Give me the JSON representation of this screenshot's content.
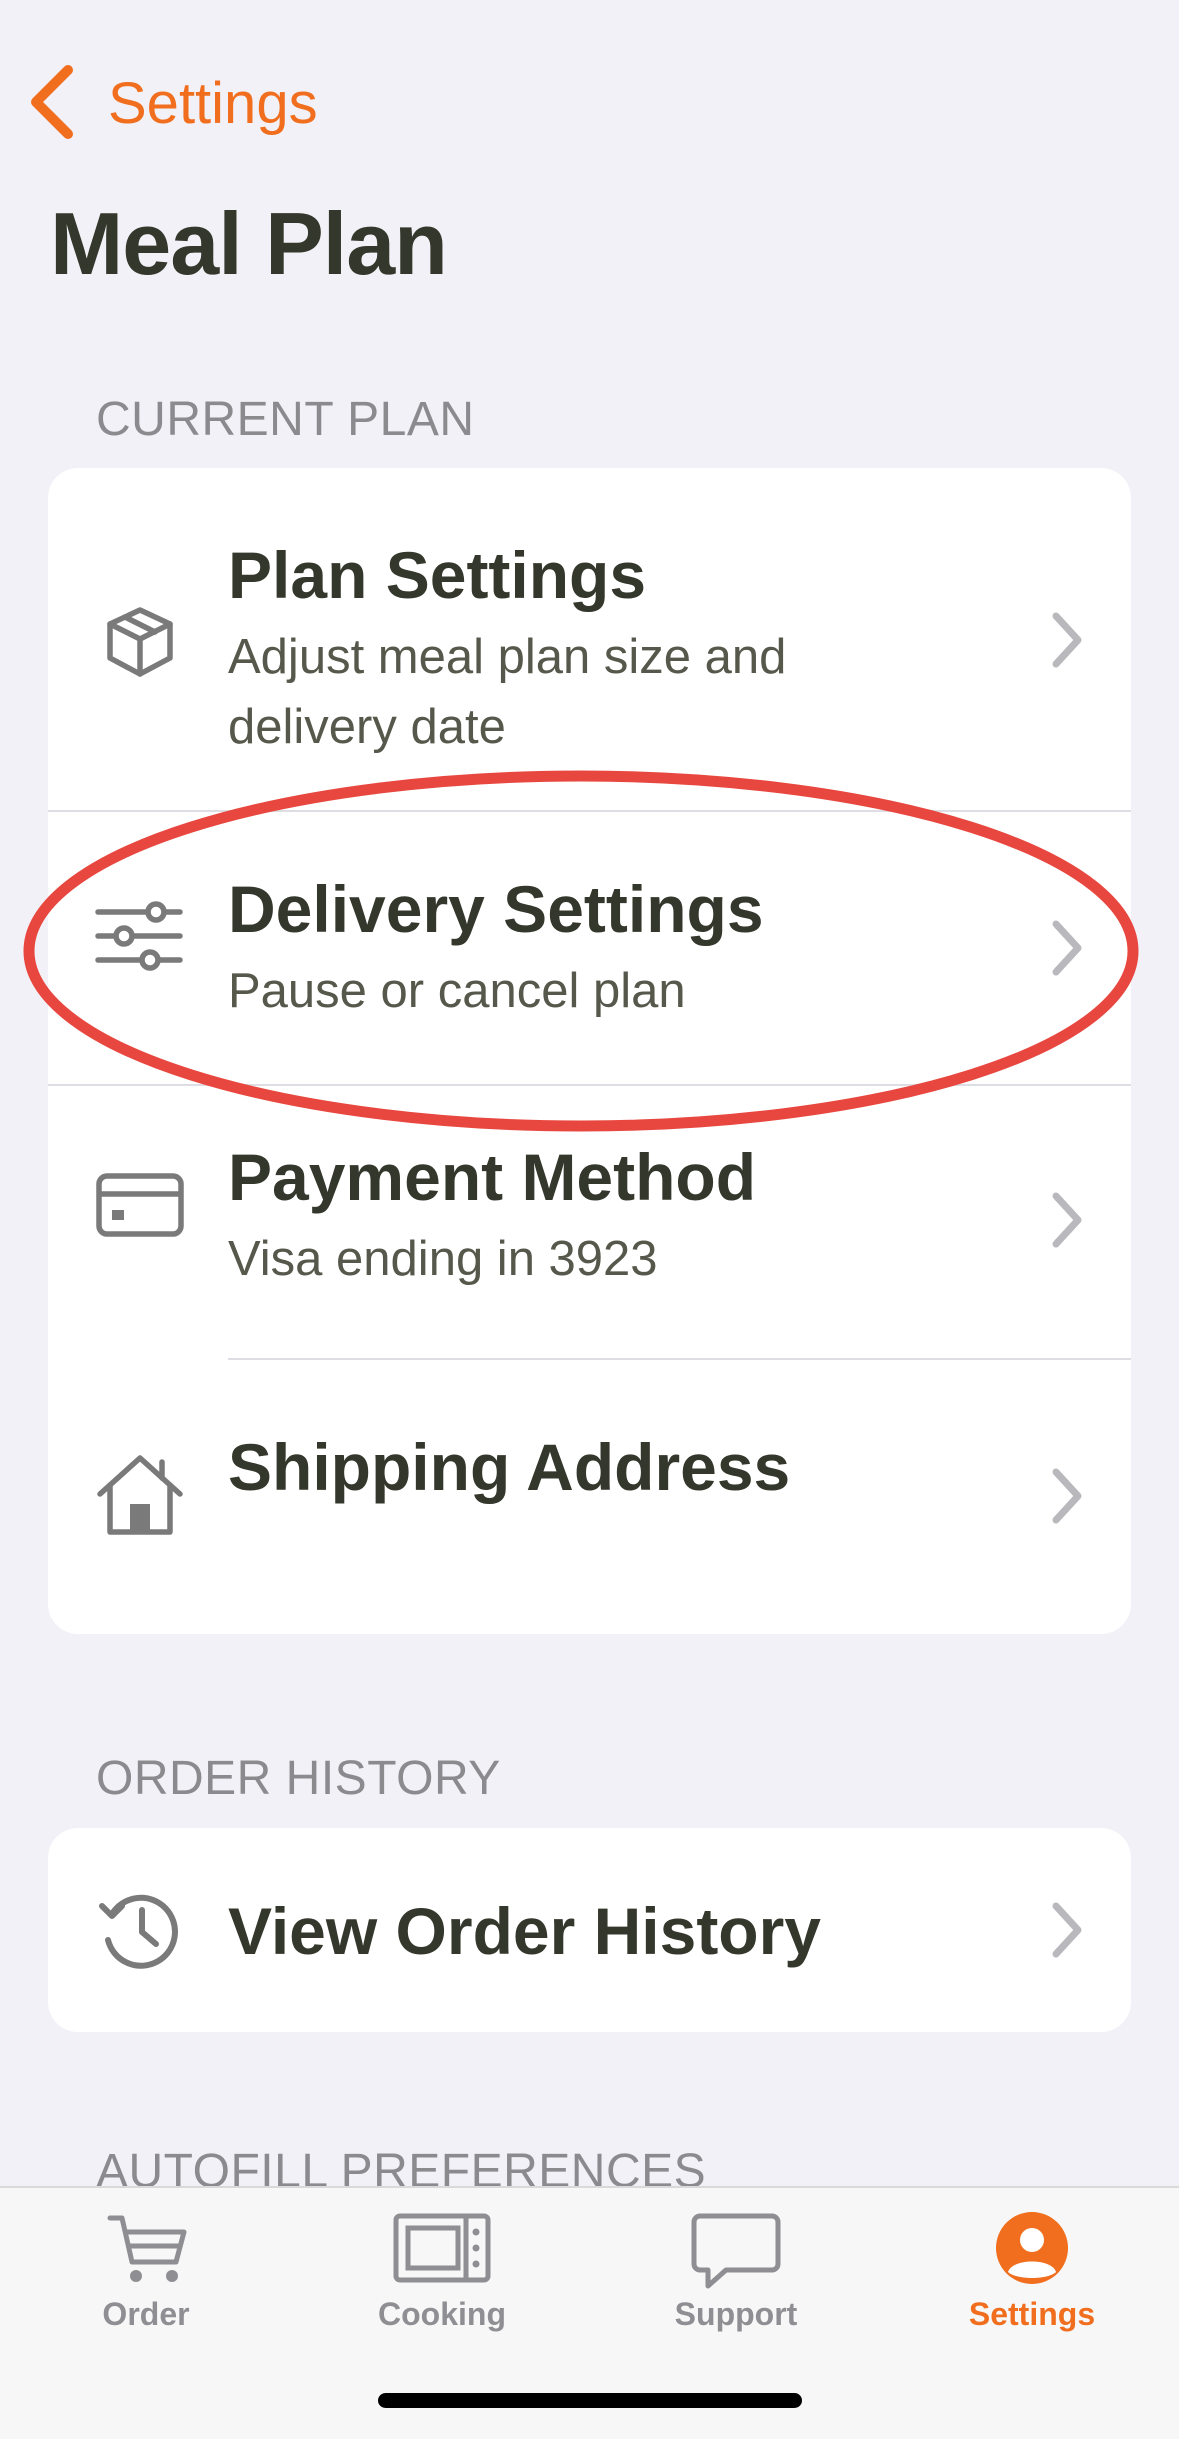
{
  "nav": {
    "back_label": "Settings"
  },
  "page_title": "Meal Plan",
  "sections": {
    "current_plan": "CURRENT PLAN",
    "order_history": "ORDER HISTORY",
    "autofill": "AUTOFILL PREFERENCES"
  },
  "current_plan_rows": [
    {
      "title": "Plan Settings",
      "subtitle": "Adjust meal plan size and delivery date",
      "icon": "box-icon"
    },
    {
      "title": "Delivery Settings",
      "subtitle": "Pause or cancel plan",
      "icon": "sliders-icon"
    },
    {
      "title": "Payment Method",
      "subtitle": "Visa ending in 3923",
      "icon": "credit-card-icon"
    },
    {
      "title": "Shipping Address",
      "icon": "house-icon"
    }
  ],
  "order_history_row": {
    "title": "View Order History",
    "icon": "history-icon"
  },
  "tabs": [
    {
      "label": "Order",
      "icon": "cart-icon",
      "active": false
    },
    {
      "label": "Cooking",
      "icon": "microwave-icon",
      "active": false
    },
    {
      "label": "Support",
      "icon": "chat-bubble-icon",
      "active": false
    },
    {
      "label": "Settings",
      "icon": "person-icon",
      "active": true
    }
  ],
  "colors": {
    "accent": "#f06e1e",
    "background": "#f2f1f7",
    "card": "#ffffff",
    "text": "#34372b",
    "secondary_text": "#8a8a8f",
    "highlight": "#e8473f"
  }
}
